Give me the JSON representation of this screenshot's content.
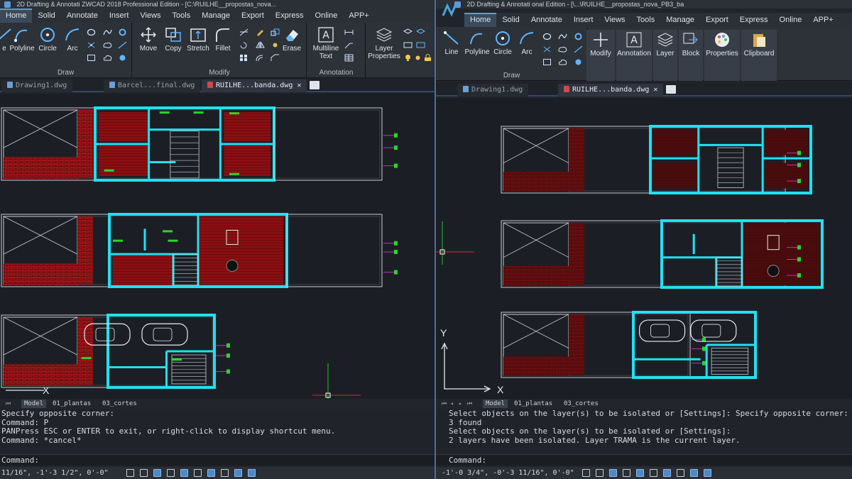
{
  "left": {
    "title_bar": "2D Drafting & Annotati  ZWCAD 2018 Professional Edition - [C:\\RUILHE__propostas_nova...",
    "menu": [
      "Home",
      "Solid",
      "Annotate",
      "Insert",
      "Views",
      "Tools",
      "Manage",
      "Export",
      "Express",
      "Online",
      "APP+"
    ],
    "ribbon_groups": {
      "draw": "Draw",
      "modify": "Modify",
      "annotation": "Annotation"
    },
    "tools": {
      "line": "e",
      "polyline": "Polyline",
      "circle": "Circle",
      "arc": "Arc",
      "move": "Move",
      "copy": "Copy",
      "stretch": "Stretch",
      "fillet": "Fillet",
      "erase": "Erase",
      "multiline_text_1": "Multiline",
      "multiline_text_2": "Text",
      "layer_properties_1": "Layer",
      "layer_properties_2": "Properties"
    },
    "tabs": [
      {
        "label": "Drawing1.dwg",
        "active": false
      },
      {
        "label": "Barcel...final.dwg",
        "active": false
      },
      {
        "label": "RUILHE...banda.dwg",
        "active": true
      }
    ],
    "tab_close": "✕",
    "layout_tabs": [
      "Model",
      "01_plantas",
      "03_cortes"
    ],
    "command_history": [
      "Specify opposite corner:",
      "Command: P",
      "PANPress ESC or ENTER to exit, or right-click to display shortcut menu.",
      "Command: *cancel*"
    ],
    "command_prompt": "Command:",
    "coords": "11/16\", -1'-3 1/2\", 0'-0\"",
    "ucs_x_label": "X"
  },
  "right": {
    "title_bar": "2D Drafting & Annotati   onal Edition - [\\...\\RUILHE__propostas_nova_PB3_ba",
    "menu": [
      "Home",
      "Solid",
      "Annotate",
      "Insert",
      "Views",
      "Tools",
      "Manage",
      "Export",
      "Express",
      "Online",
      "APP+"
    ],
    "ribbon_groups": {
      "draw": "Draw"
    },
    "tools": {
      "line": "Line",
      "polyline": "Polyline",
      "circle": "Circle",
      "arc": "Arc",
      "modify": "Modify",
      "annotation": "Annotation",
      "layer": "Layer",
      "block": "Block",
      "properties": "Properties",
      "clipboard": "Clipboard"
    },
    "tabs": [
      {
        "label": "Drawing1.dwg",
        "active": false
      },
      {
        "label": "RUILHE...banda.dwg",
        "active": true
      }
    ],
    "tab_close": "✕",
    "layout_tabs": [
      "Model",
      "01_plantas",
      "03_cortes"
    ],
    "command_history": [
      "Select objects on the layer(s) to be isolated or [Settings]: Specify opposite corner:",
      "3 found",
      "Select objects on the layer(s) to be isolated or [Settings]:",
      "2 layers have been isolated. Layer TRAMA is the current layer."
    ],
    "command_prompt": "Command:",
    "coords": "-1'-0 3/4\", -0'-3 11/16\", 0'-0\"",
    "ucs_x_label": "X",
    "ucs_y_label": "Y"
  },
  "colors": {
    "wall": "#22e0f0",
    "hatch_red": "#8b0f12",
    "brick": "#a01518",
    "green": "#2bd52b",
    "magenta": "#c02fc0",
    "line": "#c8ccd2",
    "dim_red": "#5a1a1c"
  }
}
